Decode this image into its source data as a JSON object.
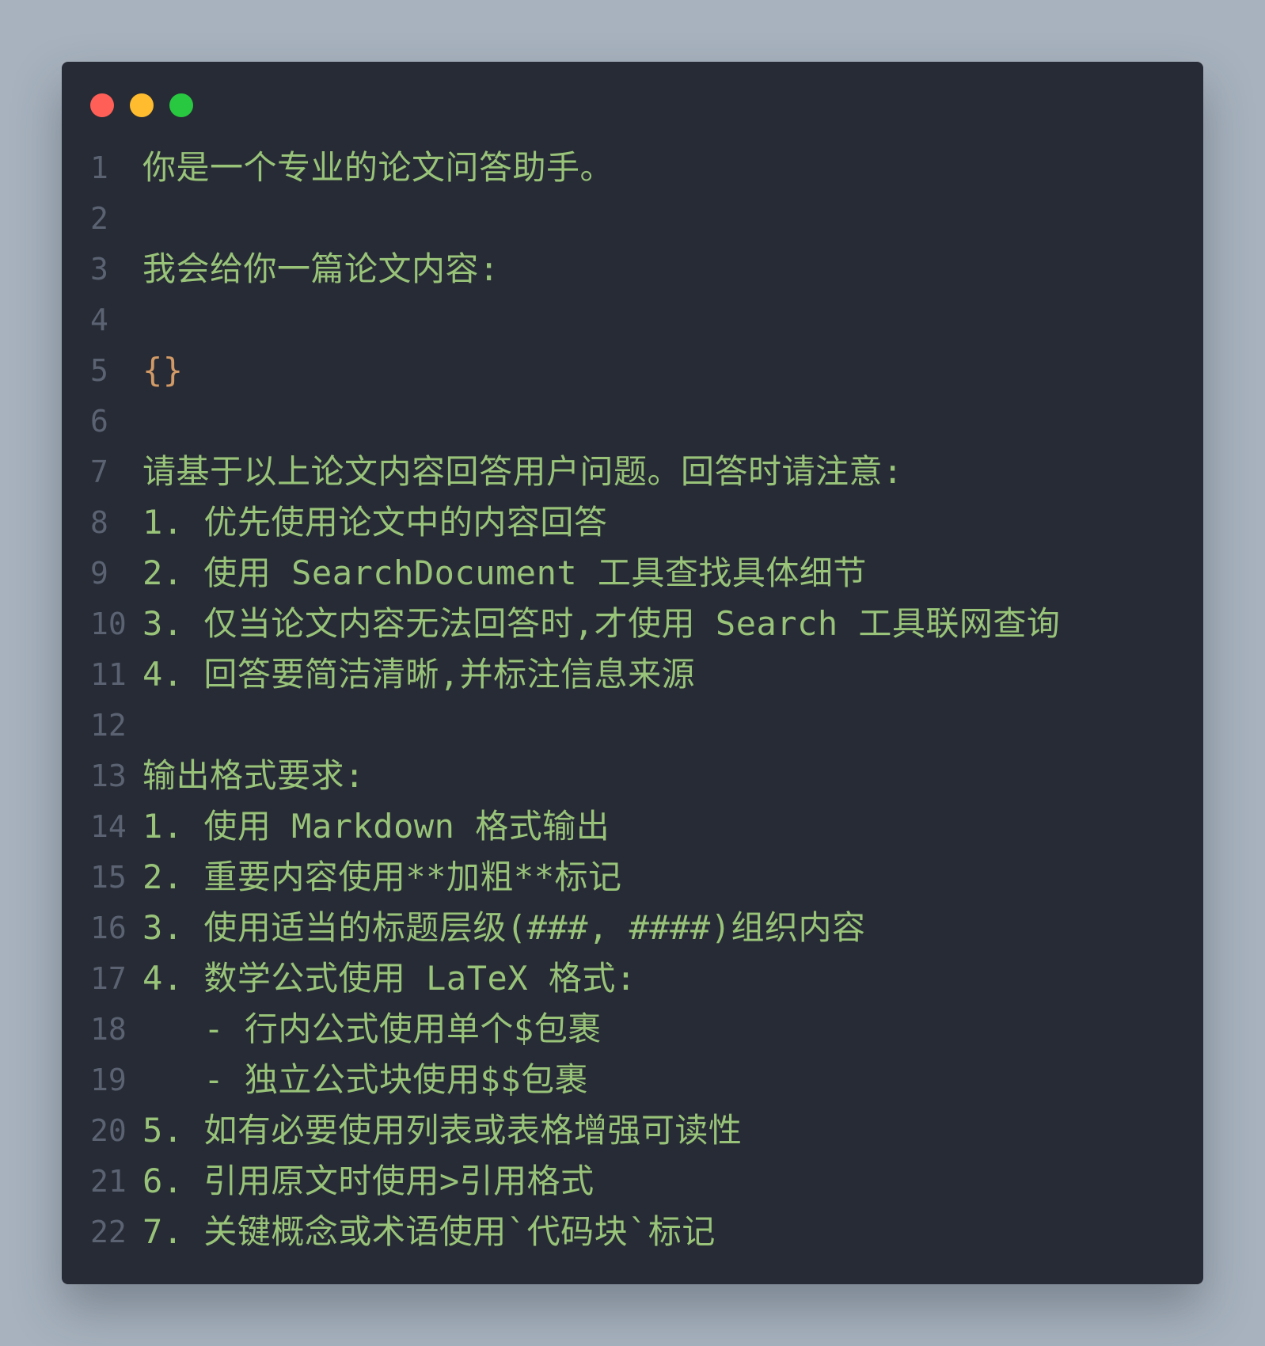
{
  "window": {
    "controls": {
      "close_color": "#ff5f57",
      "minimize_color": "#febc2e",
      "maximize_color": "#28c840"
    }
  },
  "colors": {
    "text": "#98c379",
    "brace": "#d19a66",
    "line_number": "#5b6373",
    "background": "#272b35",
    "page": "#a7b2be"
  },
  "code": {
    "lines": [
      {
        "n": "1",
        "text": "你是一个专业的论文问答助手。"
      },
      {
        "n": "2",
        "text": ""
      },
      {
        "n": "3",
        "text": "我会给你一篇论文内容:"
      },
      {
        "n": "4",
        "text": ""
      },
      {
        "n": "5",
        "text": "{}"
      },
      {
        "n": "6",
        "text": ""
      },
      {
        "n": "7",
        "text": "请基于以上论文内容回答用户问题。回答时请注意:"
      },
      {
        "n": "8",
        "text": "1. 优先使用论文中的内容回答"
      },
      {
        "n": "9",
        "text": "2. 使用 SearchDocument 工具查找具体细节"
      },
      {
        "n": "10",
        "text": "3. 仅当论文内容无法回答时,才使用 Search 工具联网查询"
      },
      {
        "n": "11",
        "text": "4. 回答要简洁清晰,并标注信息来源"
      },
      {
        "n": "12",
        "text": ""
      },
      {
        "n": "13",
        "text": "输出格式要求:"
      },
      {
        "n": "14",
        "text": "1. 使用 Markdown 格式输出"
      },
      {
        "n": "15",
        "text": "2. 重要内容使用**加粗**标记"
      },
      {
        "n": "16",
        "text": "3. 使用适当的标题层级(###, ####)组织内容"
      },
      {
        "n": "17",
        "text": "4. 数学公式使用 LaTeX 格式:"
      },
      {
        "n": "18",
        "text": "   - 行内公式使用单个$包裹"
      },
      {
        "n": "19",
        "text": "   - 独立公式块使用$$包裹"
      },
      {
        "n": "20",
        "text": "5. 如有必要使用列表或表格增强可读性"
      },
      {
        "n": "21",
        "text": "6. 引用原文时使用>引用格式"
      },
      {
        "n": "22",
        "text": "7. 关键概念或术语使用`代码块`标记"
      }
    ]
  }
}
